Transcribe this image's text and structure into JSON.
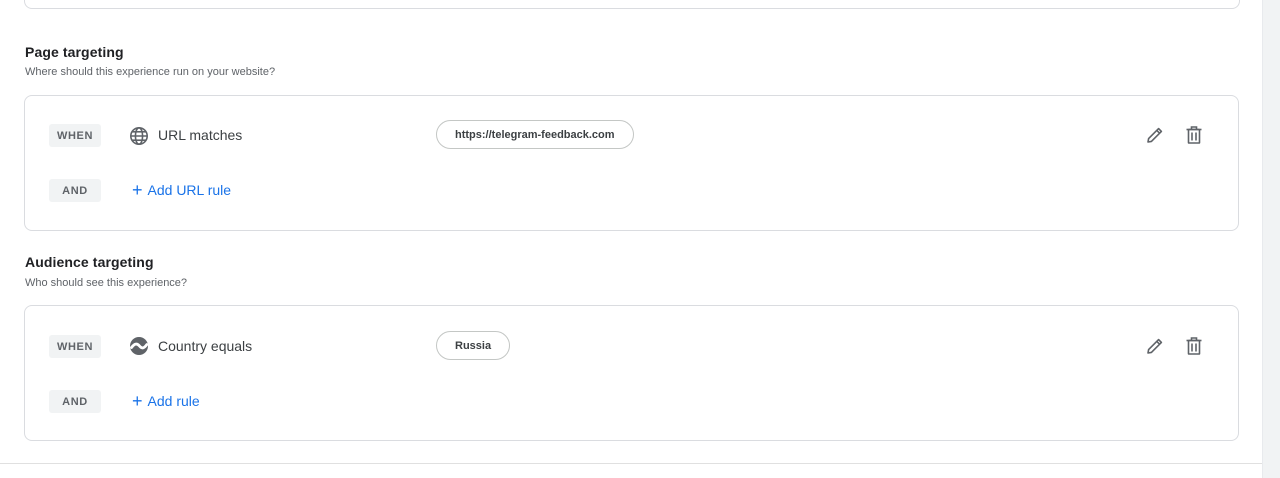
{
  "page_targeting": {
    "title": "Page targeting",
    "subtitle": "Where should this experience run on your website?",
    "rule": {
      "operator": "WHEN",
      "icon": "globe-icon",
      "condition": "URL matches",
      "value": "https://telegram-feedback.com"
    },
    "and_label": "AND",
    "add_label": "Add URL rule"
  },
  "audience_targeting": {
    "title": "Audience targeting",
    "subtitle": "Who should see this experience?",
    "rule": {
      "operator": "WHEN",
      "icon": "google-analytics-icon",
      "condition": "Country equals",
      "value": "Russia"
    },
    "and_label": "AND",
    "add_label": "Add rule"
  },
  "colors": {
    "link": "#1a73e8",
    "chip_bg": "#f1f3f4",
    "border": "#dadce0"
  }
}
